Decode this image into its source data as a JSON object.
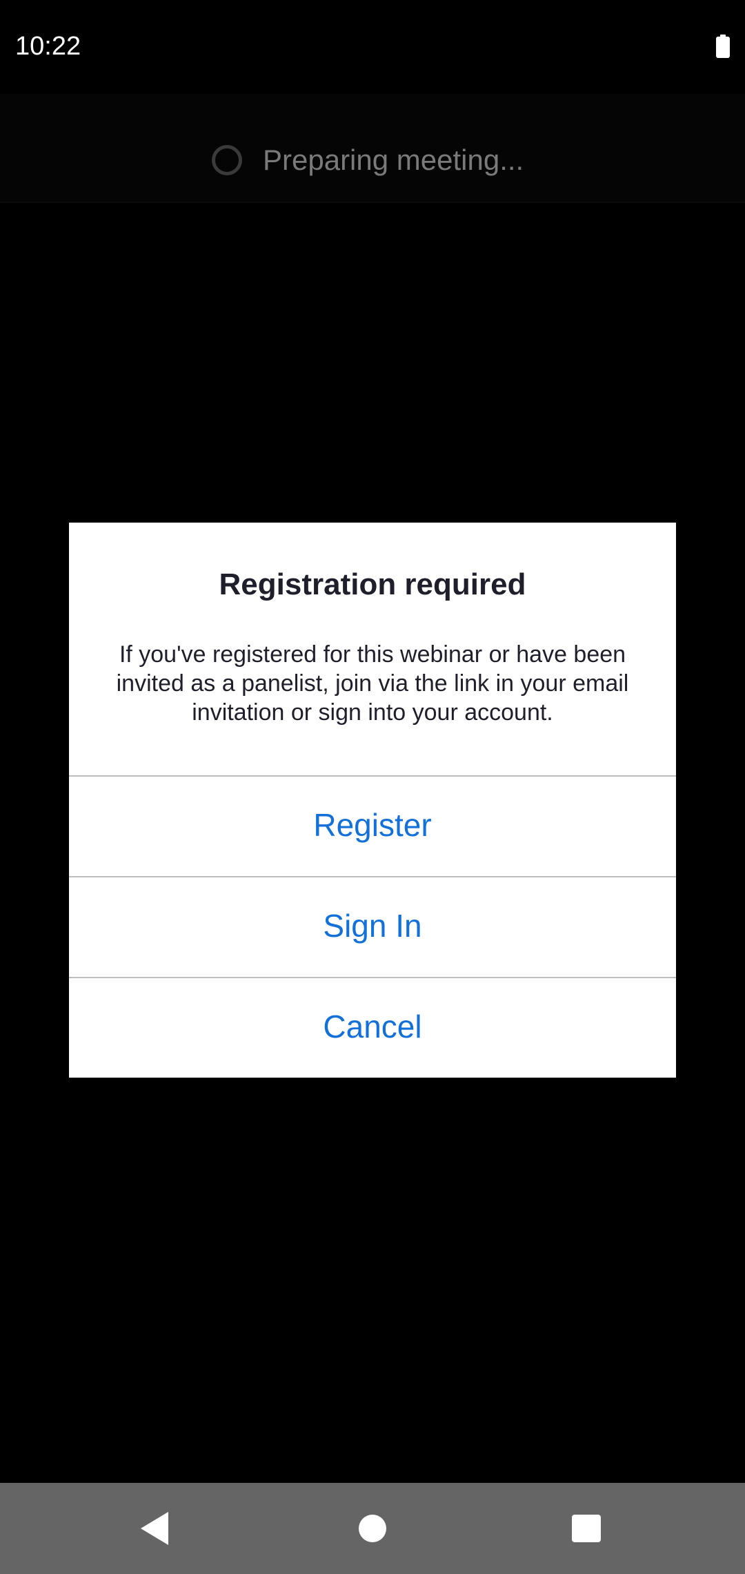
{
  "status_bar": {
    "time": "10:22",
    "battery_icon": "battery-full-icon"
  },
  "top_bar": {
    "spinner_icon": "loading-spinner-icon",
    "text": "Preparing meeting..."
  },
  "dialog": {
    "title": "Registration required",
    "message": "If you've registered for this webinar or have been invited as a panelist, join via the link in your email invitation or sign into your account.",
    "buttons": {
      "register": "Register",
      "sign_in": "Sign In",
      "cancel": "Cancel"
    },
    "accent_color": "#1370d8"
  },
  "nav_bar": {
    "back_icon": "back-triangle-icon",
    "home_icon": "home-circle-icon",
    "recents_icon": "recents-square-icon"
  }
}
